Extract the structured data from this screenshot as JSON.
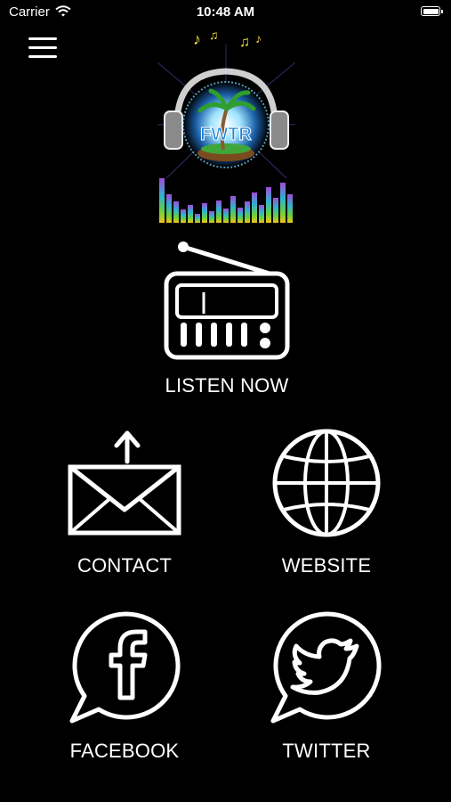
{
  "status_bar": {
    "carrier": "Carrier",
    "time": "10:48 AM"
  },
  "menu": {
    "icon": "hamburger-menu-icon"
  },
  "logo": {
    "text": "FWTR",
    "icon": "station-logo"
  },
  "buttons": {
    "listen": {
      "label": "LISTEN NOW",
      "icon": "radio-icon"
    },
    "contact": {
      "label": "CONTACT",
      "icon": "mail-icon"
    },
    "website": {
      "label": "WEBSITE",
      "icon": "globe-icon"
    },
    "facebook": {
      "label": "FACEBOOK",
      "icon": "facebook-icon"
    },
    "twitter": {
      "label": "TWITTER",
      "icon": "twitter-icon"
    }
  },
  "colors": {
    "background": "#000000",
    "foreground": "#ffffff"
  }
}
